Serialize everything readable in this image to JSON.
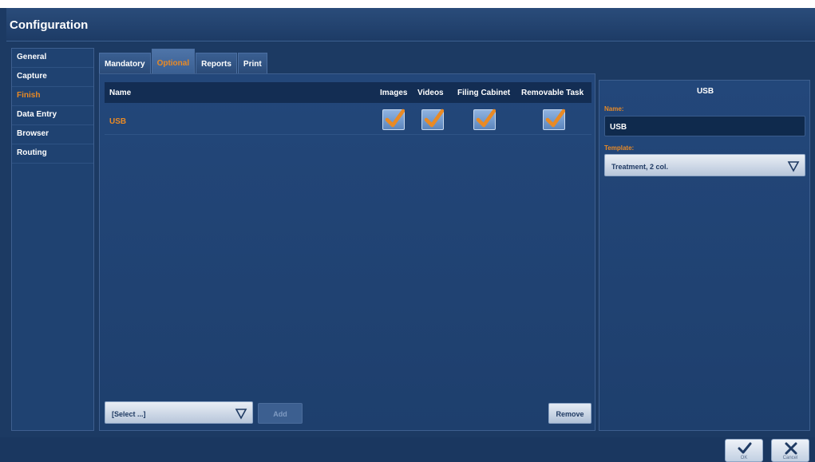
{
  "window": {
    "title": "Configuration"
  },
  "sidebar": {
    "items": [
      {
        "label": "General",
        "active": false
      },
      {
        "label": "Capture",
        "active": false
      },
      {
        "label": "Finish",
        "active": true
      },
      {
        "label": "Data Entry",
        "active": false
      },
      {
        "label": "Browser",
        "active": false
      },
      {
        "label": "Routing",
        "active": false
      }
    ]
  },
  "tabs": [
    {
      "label": "Mandatory",
      "active": false
    },
    {
      "label": "Optional",
      "active": true
    },
    {
      "label": "Reports",
      "active": false
    },
    {
      "label": "Print",
      "active": false
    }
  ],
  "grid": {
    "columns": [
      "Name",
      "Images",
      "Videos",
      "Filing Cabinet",
      "Removable Task"
    ],
    "rows": [
      {
        "name": "USB",
        "images": true,
        "videos": true,
        "filing_cabinet": true,
        "removable_task": true
      }
    ]
  },
  "bottom": {
    "select_label": "[Select ...]",
    "add_label": "Add",
    "remove_label": "Remove"
  },
  "detail": {
    "title": "USB",
    "name_label": "Name:",
    "name_value": "USB",
    "template_label": "Template:",
    "template_value": "Treatment, 2 col."
  },
  "footer": {
    "ok_label": "OK",
    "cancel_label": "Cancel"
  },
  "colors": {
    "accent": "#e98a25",
    "background": "#1c3a63",
    "header": "#132d53"
  },
  "icons": {
    "check": "checkmark-icon",
    "dropdown": "triangle-down-icon",
    "ok": "ok-check-icon",
    "cancel": "close-x-icon"
  }
}
